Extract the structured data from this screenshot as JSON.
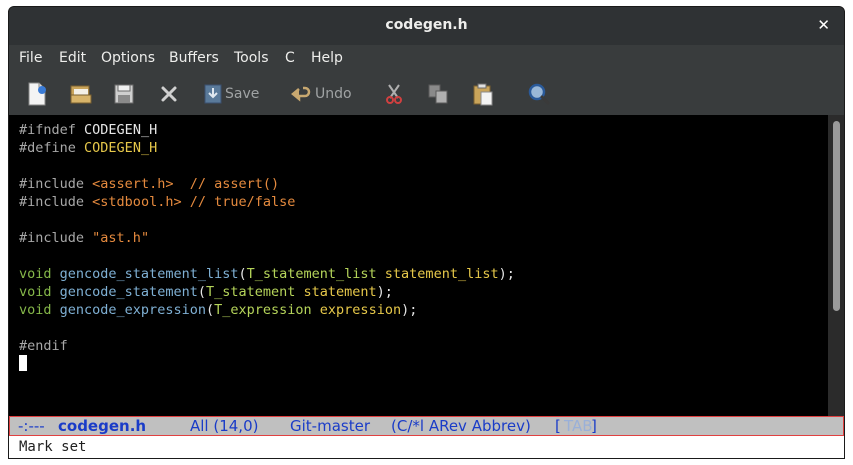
{
  "window": {
    "title": "codegen.h",
    "close_glyph": "✕"
  },
  "menu": [
    "File",
    "Edit",
    "Options",
    "Buffers",
    "Tools",
    "C",
    "Help"
  ],
  "toolbar": {
    "save_label": "Save",
    "undo_label": "Undo"
  },
  "code": {
    "l1_pp": "#ifndef",
    "l1_name": "CODEGEN_H",
    "l2_pp": "#define",
    "l2_name": "CODEGEN_H",
    "l4_pp": "#include",
    "l4_file": "<assert.h>",
    "l4_comment": "// assert()",
    "l5_pp": "#include",
    "l5_file": "<stdbool.h>",
    "l5_comment": "// true/false",
    "l7_pp": "#include",
    "l7_file": "\"ast.h\"",
    "l9_kw": "void",
    "l9_fn": "gencode_statement_list",
    "l9_ty": "T_statement_list",
    "l9_var": "statement_list",
    "l10_kw": "void",
    "l10_fn": "gencode_statement",
    "l10_ty": "T_statement",
    "l10_var": "statement",
    "l11_kw": "void",
    "l11_fn": "gencode_expression",
    "l11_ty": "T_expression",
    "l11_var": "expression",
    "l13_pp": "#endif"
  },
  "modeline": {
    "status": "-:---",
    "buffer": "codegen.h",
    "position": "All (14,0)",
    "vc": "Git-master",
    "modes": "(C/*l ARev Abbrev)",
    "extra_open": "[",
    "extra": "TAB",
    "extra_close": "]"
  },
  "echo": "Mark set",
  "colors": {
    "background": "#000000",
    "modeline_bg": "#c0c0c0",
    "modeline_fg": "#1a3cc8"
  }
}
